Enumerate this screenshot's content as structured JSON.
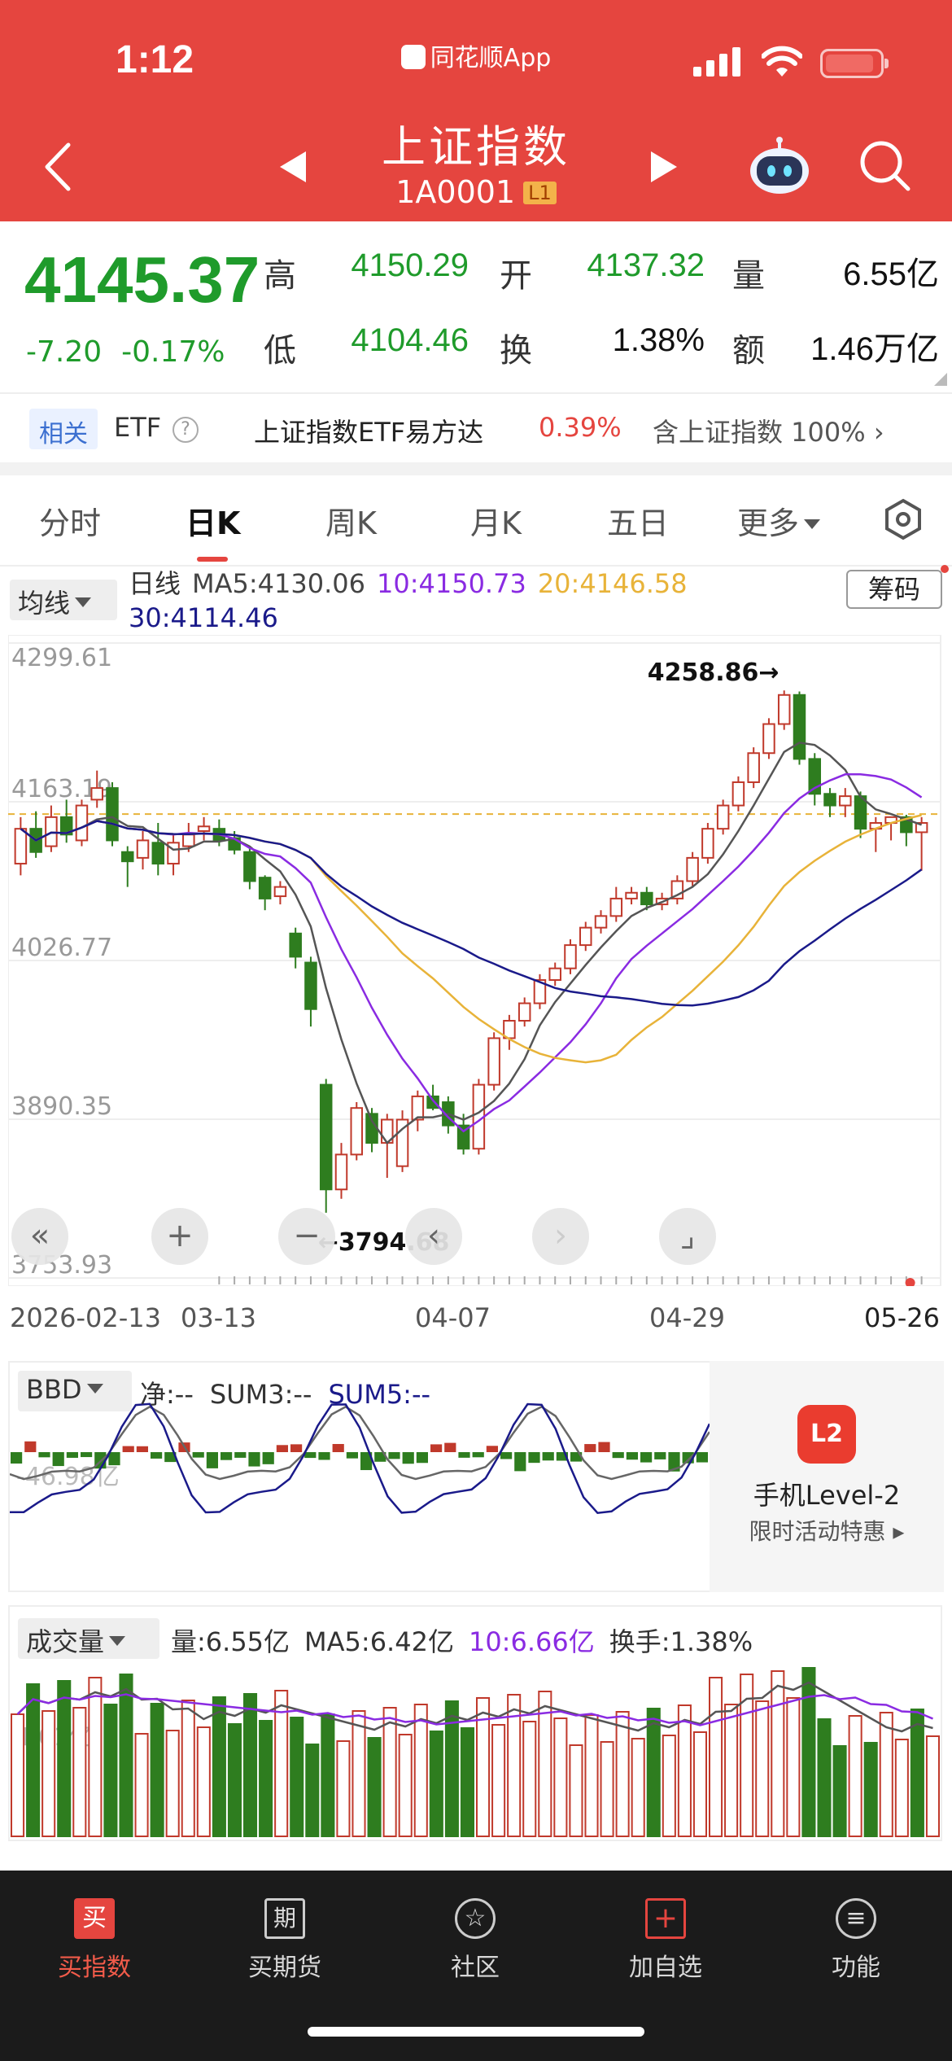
{
  "status_bar": {
    "time": "1:12",
    "app_name": "同花顺App"
  },
  "header": {
    "title": "上证指数",
    "code": "1A0001",
    "level_badge": "L1"
  },
  "quote": {
    "price": "4145.37",
    "change": "-7.20",
    "change_pct": "-0.17%",
    "rows": [
      [
        {
          "label": "高",
          "value": "4150.29"
        },
        {
          "label": "开",
          "value": "4137.32"
        },
        {
          "label": "量",
          "value": "6.55亿"
        }
      ],
      [
        {
          "label": "低",
          "value": "4104.46"
        },
        {
          "label": "换",
          "value": "1.38%"
        },
        {
          "label": "额",
          "value": "1.46万亿"
        }
      ]
    ]
  },
  "related": {
    "tag": "相关",
    "etf_label": "ETF",
    "help": "?",
    "etf_name": "上证指数ETF易方达",
    "etf_pct": "0.39%",
    "contains": "含上证指数 100% ›"
  },
  "tabs": {
    "t1": "分时",
    "t2": "日K",
    "t3": "周K",
    "t4": "月K",
    "t5": "五日",
    "t6": "更多"
  },
  "ma_legend": {
    "select": "均线",
    "period": "日线",
    "ma5": "MA5:4130.06",
    "ma10": "10:4150.73",
    "ma20": "20:4146.58",
    "ma30": "30:4114.46",
    "chip": "筹码"
  },
  "chart_data": {
    "type": "candlestick",
    "y_ticks": [
      "4299.61",
      "4163.19",
      "4026.77",
      "3890.35",
      "3753.93"
    ],
    "ylim": [
      3753.93,
      4299.61
    ],
    "annotations": {
      "high": "4258.86→",
      "low": "←3794.68"
    },
    "x_ticks": [
      "2026-02-13",
      "03-13",
      "04-07",
      "04-29",
      "05-26"
    ],
    "candles": [
      [
        4110,
        4140,
        4150,
        4100
      ],
      [
        4140,
        4120,
        4155,
        4115
      ],
      [
        4125,
        4150,
        4160,
        4120
      ],
      [
        4150,
        4135,
        4165,
        4128
      ],
      [
        4130,
        4160,
        4165,
        4125
      ],
      [
        4165,
        4175,
        4190,
        4158
      ],
      [
        4175,
        4130,
        4180,
        4125
      ],
      [
        4120,
        4112,
        4125,
        4090
      ],
      [
        4115,
        4130,
        4138,
        4105
      ],
      [
        4128,
        4110,
        4145,
        4100
      ],
      [
        4110,
        4128,
        4135,
        4100
      ],
      [
        4125,
        4135,
        4145,
        4120
      ],
      [
        4138,
        4142,
        4150,
        4130
      ],
      [
        4140,
        4130,
        4148,
        4125
      ],
      [
        4132,
        4122,
        4138,
        4118
      ],
      [
        4120,
        4095,
        4125,
        4088
      ],
      [
        4098,
        4080,
        4100,
        4070
      ],
      [
        4082,
        4090,
        4095,
        4075
      ],
      [
        4050,
        4030,
        4055,
        4020
      ],
      [
        4025,
        3985,
        4030,
        3970
      ],
      [
        3920,
        3830,
        3925,
        3810
      ],
      [
        3830,
        3860,
        3870,
        3822
      ],
      [
        3860,
        3900,
        3905,
        3855
      ],
      [
        3895,
        3870,
        3900,
        3862
      ],
      [
        3870,
        3890,
        3895,
        3840
      ],
      [
        3850,
        3890,
        3898,
        3845
      ],
      [
        3890,
        3910,
        3915,
        3880
      ],
      [
        3910,
        3900,
        3920,
        3898
      ],
      [
        3905,
        3885,
        3910,
        3878
      ],
      [
        3885,
        3865,
        3895,
        3860
      ],
      [
        3865,
        3920,
        3925,
        3860
      ],
      [
        3920,
        3960,
        3965,
        3915
      ],
      [
        3960,
        3975,
        3980,
        3950
      ],
      [
        3975,
        3990,
        3995,
        3970
      ],
      [
        3990,
        4010,
        4015,
        3985
      ],
      [
        4010,
        4020,
        4025,
        4005
      ],
      [
        4020,
        4040,
        4045,
        4015
      ],
      [
        4040,
        4055,
        4060,
        4035
      ],
      [
        4055,
        4065,
        4070,
        4050
      ],
      [
        4065,
        4080,
        4090,
        4060
      ],
      [
        4080,
        4085,
        4090,
        4075
      ],
      [
        4085,
        4075,
        4090,
        4070
      ],
      [
        4075,
        4080,
        4085,
        4070
      ],
      [
        4080,
        4095,
        4100,
        4075
      ],
      [
        4095,
        4115,
        4120,
        4090
      ],
      [
        4115,
        4140,
        4145,
        4110
      ],
      [
        4140,
        4160,
        4165,
        4135
      ],
      [
        4160,
        4180,
        4185,
        4155
      ],
      [
        4180,
        4205,
        4210,
        4175
      ],
      [
        4205,
        4230,
        4235,
        4200
      ],
      [
        4230,
        4255,
        4258.86,
        4225
      ],
      [
        4255,
        4200,
        4258,
        4195
      ],
      [
        4200,
        4170,
        4205,
        4160
      ],
      [
        4170,
        4160,
        4175,
        4150
      ],
      [
        4160,
        4168,
        4175,
        4150
      ],
      [
        4168,
        4140,
        4172,
        4132
      ],
      [
        4140,
        4145,
        4150,
        4120
      ],
      [
        4145,
        4150,
        4150,
        4130
      ],
      [
        4150,
        4137,
        4152,
        4125
      ],
      [
        4137,
        4145,
        4150,
        4104
      ]
    ],
    "series": [
      {
        "name": "MA5",
        "color": "#555555"
      },
      {
        "name": "MA10",
        "color": "#8a2be2"
      },
      {
        "name": "MA20",
        "color": "#e8b339"
      },
      {
        "name": "MA30",
        "color": "#1a1a8a"
      }
    ]
  },
  "chart_tools": {
    "first": "«",
    "zoom_in": "+",
    "zoom_out": "−",
    "prev": "‹",
    "next": "›",
    "fullscreen": "⌟"
  },
  "bbd": {
    "select": "BBD",
    "net": "净:--",
    "sum3": "SUM3:--",
    "sum5": "SUM5:--",
    "axis_label": "-46.98亿"
  },
  "level2_ad": {
    "icon_text": "L2",
    "title": "手机Level-2",
    "subtitle": "限时活动特惠 ▸"
  },
  "volume": {
    "select": "成交量",
    "vol": "量:6.55亿",
    "ma5": "MA5:6.42亿",
    "ma10": "10:6.66亿",
    "turnover": "换手:1.38%",
    "axis_label": "4.61亿"
  },
  "bottom_nav": [
    {
      "label": "买指数",
      "icon": "buy-icon",
      "icon_text": "买"
    },
    {
      "label": "买期货",
      "icon": "futures-icon",
      "icon_text": "期"
    },
    {
      "label": "社区",
      "icon": "community-icon",
      "icon_text": "☆"
    },
    {
      "label": "加自选",
      "icon": "add-watchlist-icon",
      "icon_text": "+"
    },
    {
      "label": "功能",
      "icon": "menu-icon",
      "icon_text": "≡"
    }
  ]
}
